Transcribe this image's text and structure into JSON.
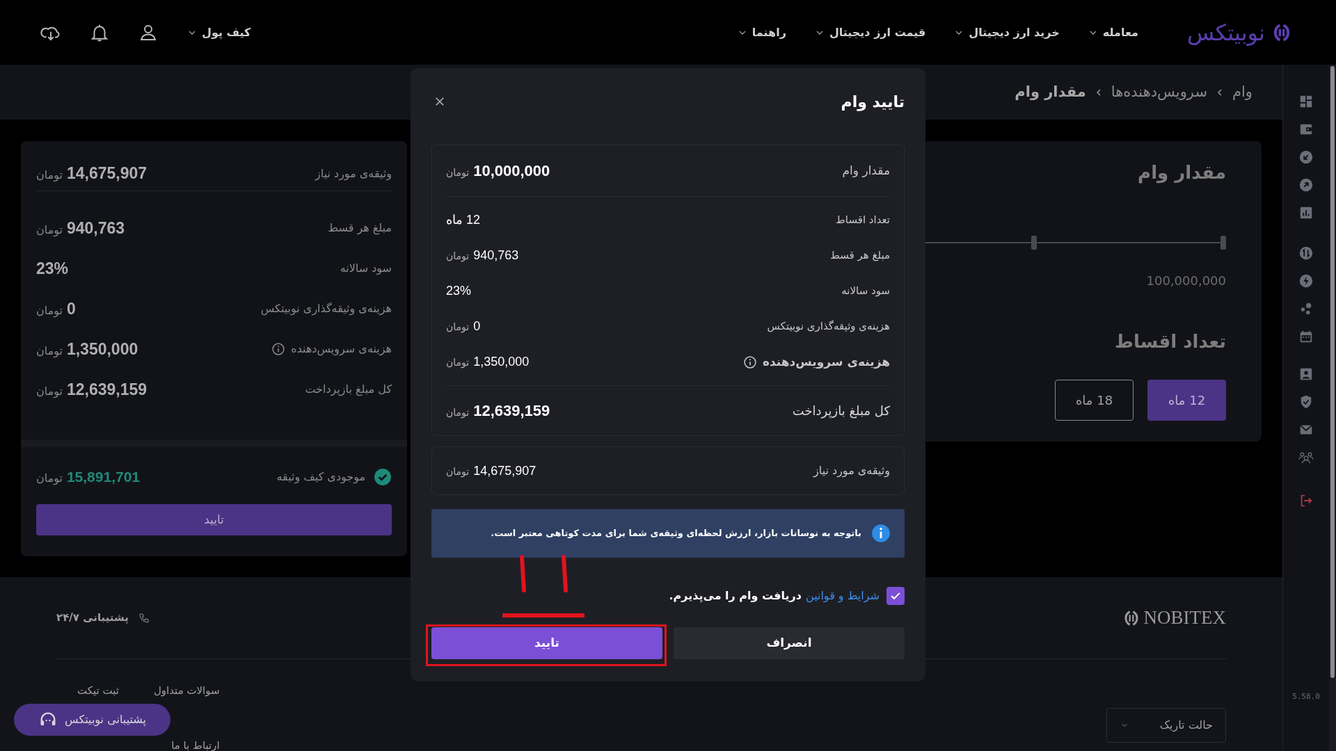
{
  "header": {
    "logo": "نوبیتکس",
    "nav": [
      {
        "label": "معامله"
      },
      {
        "label": "خرید ارز دیجیتال"
      },
      {
        "label": "قیمت ارز دیجیتال"
      },
      {
        "label": "راهنما"
      }
    ],
    "wallet": "کیف پول"
  },
  "breadcrumb": [
    "وام",
    "سرویس‌دهنده‌ها",
    "مقدار وام"
  ],
  "loan_card": {
    "title": "مقدار وام",
    "max": "100,000,000",
    "installments_title": "تعداد اقساط",
    "options": [
      {
        "label": "12 ماه",
        "selected": true
      },
      {
        "label": "18 ماه",
        "selected": false
      }
    ]
  },
  "summary_card": {
    "rows": [
      {
        "label": "وثیقه‌ی مورد نیاز",
        "value": "14,675,907",
        "unit": "تومان",
        "info": false
      },
      {
        "label": "مبلغ هر قسط",
        "value": "940,763",
        "unit": "تومان",
        "info": false
      },
      {
        "label": "سود سالانه",
        "value": "23%",
        "info": false
      },
      {
        "label": "هزینه‌ی وثیقه‌گذاری نوبیتکس",
        "value": "0",
        "unit": "تومان",
        "info": false
      },
      {
        "label": "هزینه‌ی سرویس‌دهنده",
        "value": "1,350,000",
        "unit": "تومان",
        "info": true
      },
      {
        "label": "کل مبلغ بازپرداخت",
        "value": "12,639,159",
        "unit": "تومان",
        "info": false
      }
    ],
    "balance": {
      "label": "موجودی کیف وثیقه",
      "value": "15,891,701",
      "unit": "تومان",
      "sufficient": true
    },
    "button": "تایید"
  },
  "footer": {
    "logo": "NOBITEX",
    "support": "پشتیبانی ۲۴/۷",
    "links": [
      "سوالات متداول",
      "ثبت تیکت",
      "ارتباط با ما"
    ],
    "theme": "حالت تاریک",
    "support_button": "پشتیبانی نوبیتکس"
  },
  "sidebar": {
    "version": "5.58.0"
  },
  "modal": {
    "title": "تایید وام",
    "rows": [
      {
        "kind": "main",
        "label": "مقدار وام",
        "value": "10,000,000",
        "unit": "تومان",
        "info": false
      },
      {
        "kind": "detail",
        "label": "تعداد اقساط",
        "value": "12 ماه",
        "info": false
      },
      {
        "kind": "detail",
        "label": "مبلغ هر قسط",
        "value": "940,763",
        "unit": "تومان",
        "info": false
      },
      {
        "kind": "detail",
        "label": "سود سالانه",
        "value": "23%",
        "info": false
      },
      {
        "kind": "detail",
        "label": "هزینه‌ی وثیقه‌گذاری نوبیتکس",
        "value": "0",
        "unit": "تومان",
        "info": false
      },
      {
        "kind": "detail",
        "label": "هزینه‌ی سرویس‌دهنده",
        "value": "1,350,000",
        "unit": "تومان",
        "info": true
      },
      {
        "kind": "total",
        "label": "کل مبلغ بازپرداخت",
        "value": "12,639,159",
        "unit": "تومان",
        "info": false
      }
    ],
    "collateral": {
      "label": "وثیقه‌ی مورد نیاز",
      "value": "14,675,907",
      "unit": "تومان"
    },
    "notice": "باتوجه به نوسانات بازار، ارزش لحظه‌ای وثیقه‌ی شما برای مدت کوتاهی معتبر است.",
    "terms": {
      "checked": true,
      "link": "شرایط و قوانین",
      "text": "دریافت وام را می‌پذیرم."
    },
    "buttons": {
      "cancel": "انصراف",
      "confirm": "تایید"
    }
  }
}
